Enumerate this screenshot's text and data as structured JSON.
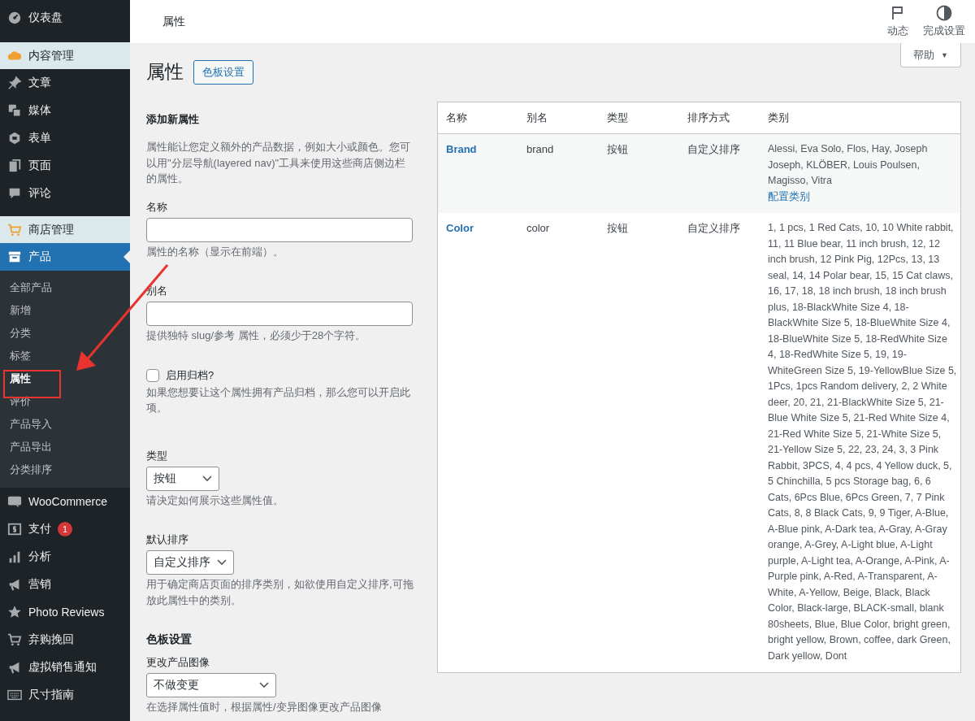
{
  "sidebar": {
    "items": [
      {
        "kind": "item",
        "label": "仪表盘"
      },
      {
        "kind": "section",
        "label": "内容管理"
      },
      {
        "kind": "item",
        "label": "文章"
      },
      {
        "kind": "item",
        "label": "媒体"
      },
      {
        "kind": "item",
        "label": "表单"
      },
      {
        "kind": "item",
        "label": "页面"
      },
      {
        "kind": "item",
        "label": "评论"
      },
      {
        "kind": "section",
        "label": "商店管理"
      },
      {
        "kind": "current",
        "label": "产品",
        "children": [
          {
            "label": "全部产品",
            "selected": false
          },
          {
            "label": "新增",
            "selected": false
          },
          {
            "label": "分类",
            "selected": false
          },
          {
            "label": "标签",
            "selected": false
          },
          {
            "label": "属性",
            "selected": true
          },
          {
            "label": "评价",
            "selected": false
          },
          {
            "label": "产品导入",
            "selected": false
          },
          {
            "label": "产品导出",
            "selected": false
          },
          {
            "label": "分类排序",
            "selected": false
          }
        ]
      },
      {
        "kind": "item",
        "label": "WooCommerce"
      },
      {
        "kind": "item",
        "label": "支付",
        "badge": "1"
      },
      {
        "kind": "item",
        "label": "分析"
      },
      {
        "kind": "item",
        "label": "营销"
      },
      {
        "kind": "item",
        "label": "Photo Reviews"
      },
      {
        "kind": "item",
        "label": "弃购挽回"
      },
      {
        "kind": "item",
        "label": "虚拟销售通知"
      },
      {
        "kind": "item",
        "label": "尺寸指南"
      }
    ]
  },
  "top_bar": {
    "title": "属性",
    "actions": [
      {
        "label": "动态"
      },
      {
        "label": "完成设置"
      }
    ],
    "help": {
      "label": "帮助",
      "caret": "▼"
    }
  },
  "page": {
    "title": "属性",
    "button": "色板设置"
  },
  "form": {
    "title": "添加新属性",
    "intro": "属性能让您定义额外的产品数据，例如大小或颜色。您可以用\"分层导航(layered nav)\"工具来使用这些商店侧边栏的属性。",
    "fields": [
      {
        "kind": "text",
        "label": "名称",
        "description": "属性的名称（显示在前端）。"
      },
      {
        "kind": "text",
        "label": "别名",
        "description": "提供独特 slug/参考 属性，必须少于28个字符。"
      },
      {
        "kind": "checkbox",
        "label": "启用归档?",
        "checked": false,
        "description": "如果您想要让这个属性拥有产品归档，那么您可以开启此项。"
      },
      {
        "kind": "select",
        "label": "类型",
        "value": "按钮",
        "description": "请决定如何展示这些属性值。"
      },
      {
        "kind": "select",
        "label": "默认排序",
        "value": "自定义排序",
        "description": "用于确定商店页面的排序类别，如欲使用自定义排序,可拖放此属性中的类别。"
      },
      {
        "kind": "heading",
        "label": "色板设置"
      },
      {
        "kind": "select",
        "label": "更改产品图像",
        "value": "不做变更",
        "description": "在选择属性值时，根据属性/变异图像更改产品图像"
      }
    ]
  },
  "table": {
    "columns": [
      "名称",
      "别名",
      "类型",
      "排序方式",
      "类别"
    ],
    "rows": [
      {
        "name": "Brand",
        "slug": "brand",
        "type": "按钮",
        "order": "自定义排序",
        "terms": "Alessi, Eva Solo, Flos, Hay, Joseph Joseph, KLÖBER, Louis Poulsen, Magisso, Vitra",
        "configure": "配置类别"
      },
      {
        "name": "Color",
        "slug": "color",
        "type": "按钮",
        "order": "自定义排序",
        "terms": "1, 1 pcs, 1 Red Cats, 10, 10 White rabbit, 11, 11 Blue bear, 11 inch brush, 12, 12 inch brush, 12 Pink Pig, 12Pcs, 13, 13 seal, 14, 14 Polar bear, 15, 15 Cat claws, 16, 17, 18, 18 inch brush, 18 inch brush plus, 18-BlackWhite Size 4, 18-BlackWhite Size 5, 18-BlueWhite Size 4, 18-BlueWhite Size 5, 18-RedWhite Size 4, 18-RedWhite Size 5, 19, 19-WhiteGreen Size 5, 19-YellowBlue Size 5, 1Pcs, 1pcs Random delivery, 2, 2 White deer, 20, 21, 21-BlackWhite Size 5, 21-Blue White Size 5, 21-Red White Size 4, 21-Red White Size 5, 21-White Size 5, 21-Yellow Size 5, 22, 23, 24, 3, 3 Pink Rabbit, 3PCS, 4, 4 pcs, 4 Yellow duck, 5, 5 Chinchilla, 5 pcs Storage bag, 6, 6 Cats, 6Pcs Blue, 6Pcs Green, 7, 7 Pink Cats, 8, 8 Black Cats, 9, 9 Tiger, A-Blue, A-Blue pink, A-Dark tea, A-Gray, A-Gray orange, A-Grey, A-Light blue, A-Light purple, A-Light tea, A-Orange, A-Pink, A-Purple pink, A-Red, A-Transparent, A-White, A-Yellow, Beige, Black, Black Color, Black-large, BLACK-small, blank 80sheets, Blue, Blue Color, bright green, bright yellow, Brown, coffee, dark Green, Dark yellow, Dont"
      }
    ]
  }
}
